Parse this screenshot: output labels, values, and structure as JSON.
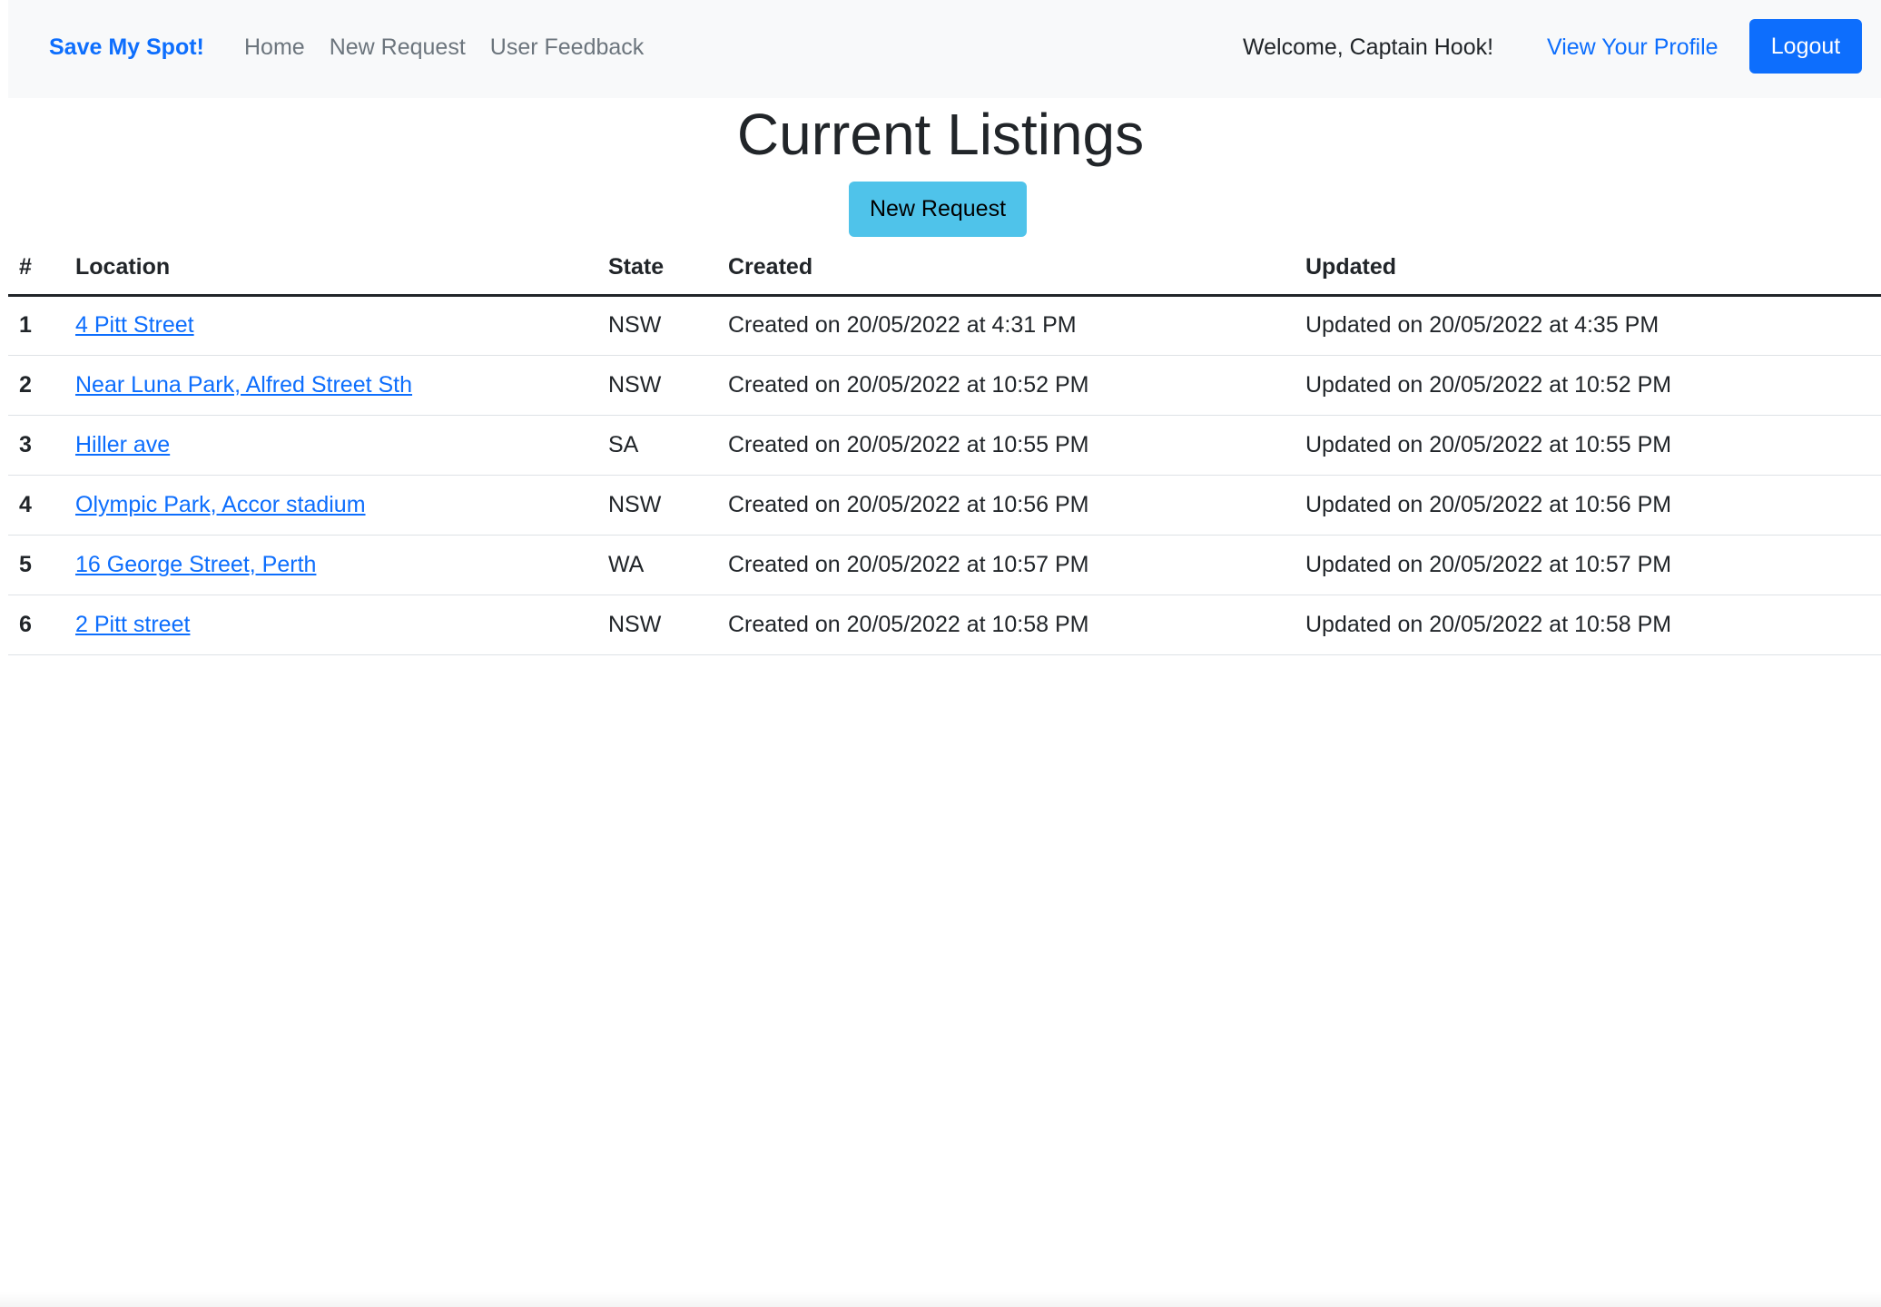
{
  "navbar": {
    "brand": "Save My Spot!",
    "links": [
      "Home",
      "New Request",
      "User Feedback"
    ],
    "welcome": "Welcome, Captain Hook!",
    "profile_link": "View Your Profile",
    "logout_label": "Logout"
  },
  "main": {
    "title": "Current Listings",
    "new_request_label": "New Request"
  },
  "table": {
    "headers": [
      "#",
      "Location",
      "State",
      "Created",
      "Updated"
    ],
    "rows": [
      {
        "num": "1",
        "location": "4 Pitt Street",
        "state": "NSW",
        "created": "Created on 20/05/2022 at 4:31 PM",
        "updated": "Updated on 20/05/2022 at 4:35 PM"
      },
      {
        "num": "2",
        "location": "Near Luna Park, Alfred Street Sth",
        "state": "NSW",
        "created": "Created on 20/05/2022 at 10:52 PM",
        "updated": "Updated on 20/05/2022 at 10:52 PM"
      },
      {
        "num": "3",
        "location": "Hiller ave",
        "state": "SA",
        "created": "Created on 20/05/2022 at 10:55 PM",
        "updated": "Updated on 20/05/2022 at 10:55 PM"
      },
      {
        "num": "4",
        "location": "Olympic Park, Accor stadium",
        "state": "NSW",
        "created": "Created on 20/05/2022 at 10:56 PM",
        "updated": "Updated on 20/05/2022 at 10:56 PM"
      },
      {
        "num": "5",
        "location": "16 George Street, Perth",
        "state": "WA",
        "created": "Created on 20/05/2022 at 10:57 PM",
        "updated": "Updated on 20/05/2022 at 10:57 PM"
      },
      {
        "num": "6",
        "location": "2 Pitt street",
        "state": "NSW",
        "created": "Created on 20/05/2022 at 10:58 PM",
        "updated": "Updated on 20/05/2022 at 10:58 PM"
      }
    ]
  },
  "colors": {
    "primary": "#0d6efd",
    "info": "#4fc3ea",
    "navbar_bg": "#f8f9fa",
    "muted": "#6c757d"
  }
}
